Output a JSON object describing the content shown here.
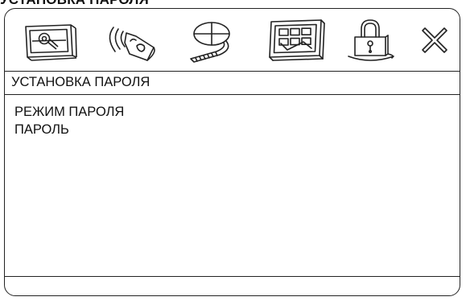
{
  "header": {
    "fragment": "УСТАНОВКА ПАРОЛЯ"
  },
  "toolbar": {
    "icons": [
      "settings-tool-icon",
      "audio-speaker-icon",
      "video-film-icon",
      "preferences-grid-icon",
      "password-lock-icon",
      "exit-close-icon"
    ],
    "active": "password-lock-icon"
  },
  "section": {
    "title": "УСТАНОВКА ПАРОЛЯ"
  },
  "menu": {
    "items": [
      {
        "label": "РЕЖИМ ПАРОЛЯ"
      },
      {
        "label": "ПАРОЛЬ"
      }
    ]
  },
  "status": {
    "text": ""
  },
  "colors": {
    "line": "#222222",
    "background": "#ffffff",
    "text": "#111111"
  }
}
